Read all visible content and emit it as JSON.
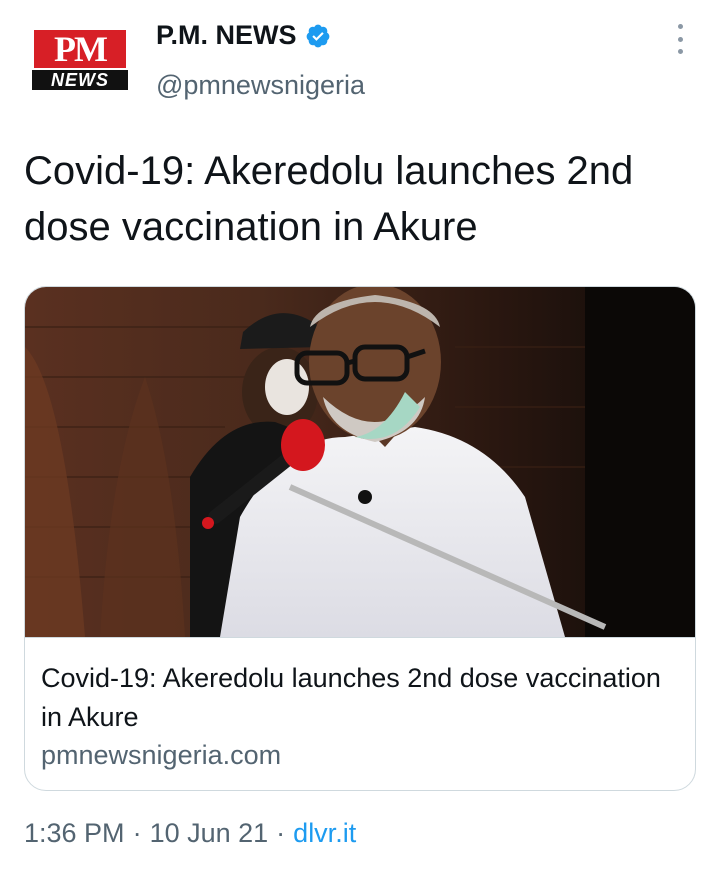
{
  "account": {
    "display_name": "P.M. NEWS",
    "handle": "@pmnewsnigeria",
    "avatar_top": "PM",
    "avatar_bottom": "NEWS",
    "verified": true
  },
  "tweet": {
    "text": "Covid-19: Akeredolu launches 2nd dose vaccination in Akure"
  },
  "card": {
    "title": "Covid-19: Akeredolu launches 2nd dose vaccination in Akure",
    "domain": "pmnewsnigeria.com"
  },
  "meta": {
    "time": "1:36 PM",
    "separator": "·",
    "date": "10 Jun 21",
    "source": "dlvr.it"
  },
  "colors": {
    "brand_red": "#d71f26",
    "verified_blue": "#1d9bf0",
    "link_blue": "#1d9bf0",
    "secondary_text": "#536471"
  }
}
